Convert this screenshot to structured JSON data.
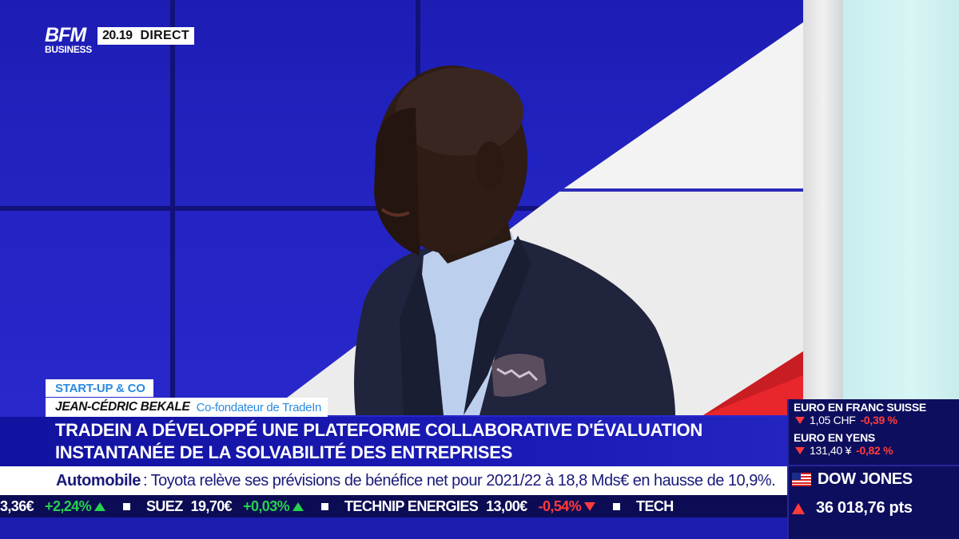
{
  "broadcast": {
    "logo_main": "BFM",
    "logo_sub": "BUSINESS",
    "time": "20.19",
    "live_label": "DIRECT"
  },
  "lower_third": {
    "category": "START-UP & CO",
    "guest_name": "JEAN-CÉDRIC BEKALE",
    "guest_role": "Co-fondateur de TradeIn",
    "headline_line1": "TRADEIN A DÉVELOPPÉ UNE PLATEFORME COLLABORATIVE D'ÉVALUATION",
    "headline_line2": "INSTANTANÉE DE LA SOLVABILITÉ DES ENTREPRISES"
  },
  "news_ticker": {
    "category": "Automobile",
    "separator": ":",
    "text": "Toyota relève ses prévisions de bénéfice net pour 2021/22 à 18,8 Mds€ en hausse de 10,9%."
  },
  "stock_ticker": [
    {
      "name": "",
      "price": "3,36€",
      "change": "+2,24%",
      "direction": "up"
    },
    {
      "name": "SUEZ",
      "price": "19,70€",
      "change": "+0,03%",
      "direction": "up"
    },
    {
      "name": "TECHNIP ENERGIES",
      "price": "13,00€",
      "change": "-0,54%",
      "direction": "down"
    },
    {
      "name": "TECH",
      "price": "",
      "change": "",
      "direction": ""
    }
  ],
  "markets": {
    "eur_chf_title": "EURO EN FRANC SUISSE",
    "eur_chf_price": "1,05 CHF",
    "eur_chf_change": "-0,39 %",
    "eur_jpy_title": "EURO EN YENS",
    "eur_jpy_price": "131,40 ¥",
    "eur_jpy_change": "-0,82 %",
    "index_title": "DOW JONES",
    "index_value": "36 018,76 pts",
    "index_flag": "us-flag-icon"
  },
  "colors": {
    "brand_blue": "#1b1bb8",
    "ticker_navy": "#0c0c55",
    "accent_light_blue": "#2a8ae0",
    "positive": "#27d24d",
    "negative": "#ff3b3b"
  }
}
